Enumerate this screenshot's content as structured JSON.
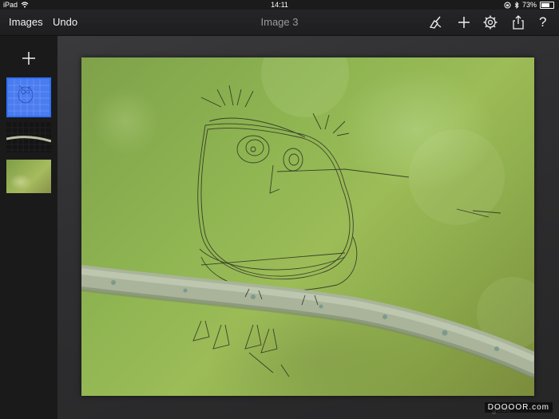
{
  "status": {
    "device": "iPad",
    "time": "14:11",
    "battery": "73%",
    "battery_level": 0.73
  },
  "toolbar": {
    "images_label": "Images",
    "undo_label": "Undo",
    "title": "Image 3",
    "help_label": "?"
  },
  "watermark": {
    "text": "DOOOOR.com",
    "faint_text": "gede"
  },
  "colors": {
    "accent": "#2f6ff4",
    "toolbar_bg": "#1e1e20",
    "sidebar_bg": "#1a1a1b"
  }
}
